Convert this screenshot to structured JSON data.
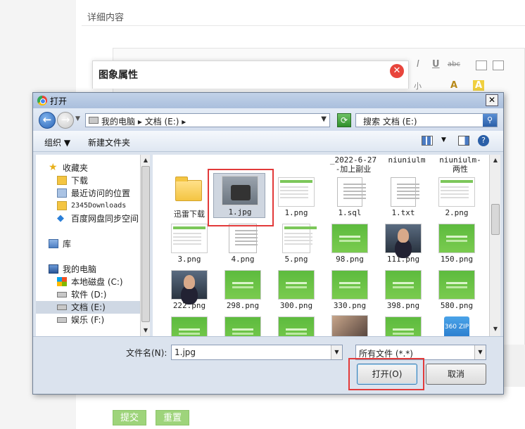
{
  "page": {
    "section_title": "详细内容",
    "submit_label": "提交",
    "reset_label": "重置",
    "toolbar": {
      "italic": "I",
      "underline": "U",
      "strike": "abc",
      "fontsize": "小",
      "font_a": "A",
      "font_a2": "A"
    }
  },
  "image_dialog": {
    "title": "图象属性",
    "close": "✕"
  },
  "open_dialog": {
    "title": "打开",
    "close": "✕",
    "breadcrumb": "我的电脑 ▸ 文档 (E:) ▸",
    "search_placeholder": "搜索 文档 (E:)",
    "organize": "组织 ▼",
    "new_folder": "新建文件夹",
    "nav": [
      {
        "label": "收藏夹",
        "icon": "star-icon"
      },
      {
        "label": "下载",
        "icon": "download-folder-icon"
      },
      {
        "label": "最近访问的位置",
        "icon": "recent-places-icon"
      },
      {
        "label": "2345Downloads",
        "icon": "folder-icon"
      },
      {
        "label": "百度网盘同步空间",
        "icon": "baidu-netdisk-icon"
      },
      {
        "label": "库",
        "icon": "library-icon"
      },
      {
        "label": "我的电脑",
        "icon": "computer-icon"
      },
      {
        "label": "本地磁盘 (C:)",
        "icon": "windows-drive-icon"
      },
      {
        "label": "软件 (D:)",
        "icon": "drive-icon"
      },
      {
        "label": "文档 (E:)",
        "icon": "drive-icon"
      },
      {
        "label": "娱乐 (F:)",
        "icon": "drive-icon"
      }
    ],
    "top_labels": [
      "_2022-6-27",
      "-加上副业",
      "niuniulm",
      "niuniulm-",
      "两性"
    ],
    "files": [
      "迅雷下载",
      "1.jpg",
      "1.png",
      "1.sql",
      "1.txt",
      "2.png",
      "3.png",
      "4.png",
      "5.png",
      "98.png",
      "111.png",
      "150.png",
      "222.png",
      "298.png",
      "300.png",
      "330.png",
      "398.png",
      "580.png"
    ],
    "zip_label": "360 ZIP",
    "filename_label": "文件名(N):",
    "filename_value": "1.jpg",
    "filetype_value": "所有文件 (*.*)",
    "open_button": "打开(O)",
    "cancel_button": "取消"
  }
}
